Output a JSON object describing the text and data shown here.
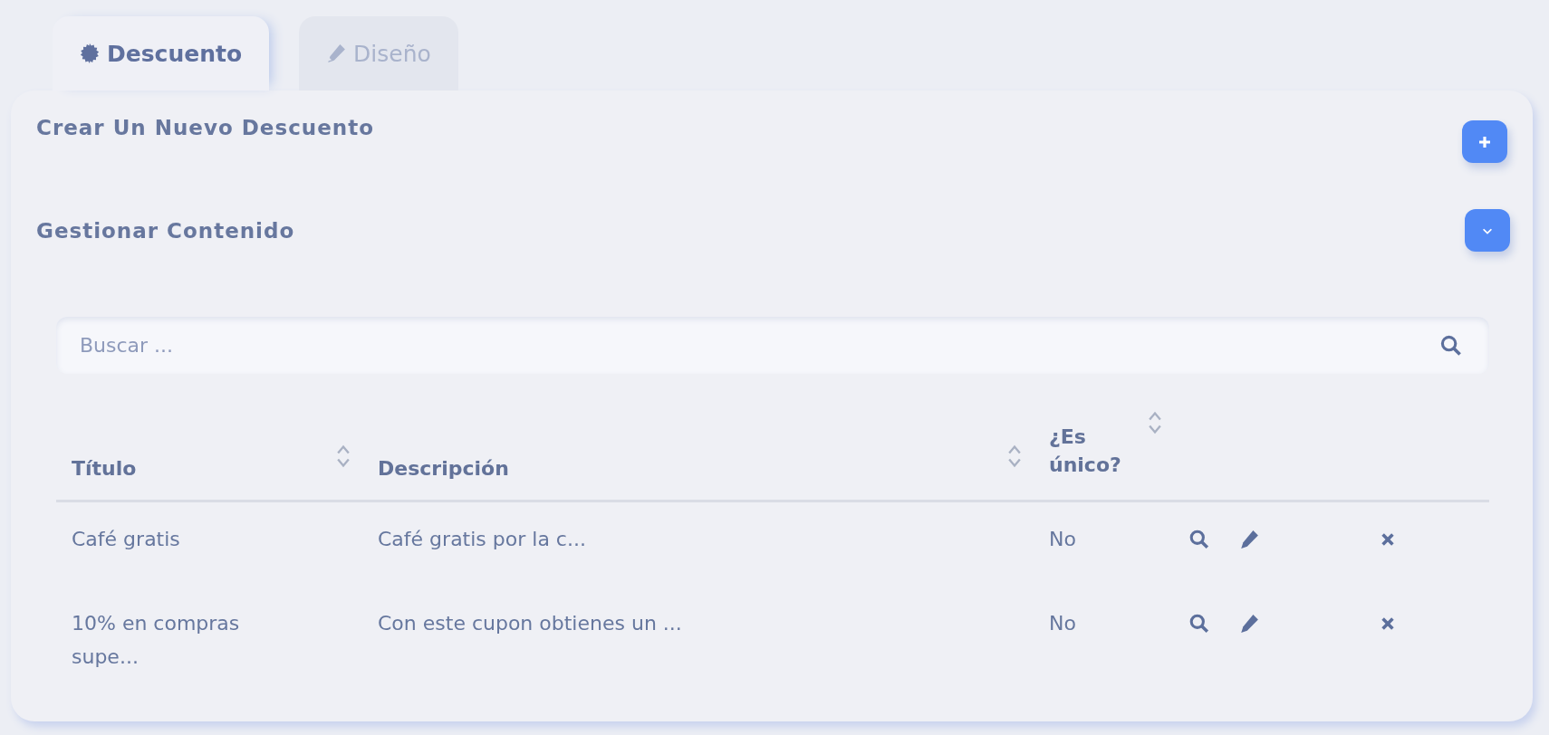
{
  "tabs": [
    {
      "label": "Descuento",
      "kind": "gear",
      "selected": true
    },
    {
      "label": "Diseño",
      "kind": "pencil",
      "selected": false
    }
  ],
  "sections": [
    {
      "title": "Crear Un Nuevo Descuento",
      "kind": "add"
    },
    {
      "title": "Gestionar Contenido",
      "kind": "expand"
    }
  ],
  "search": {
    "placeholder": "Buscar ..."
  },
  "table": {
    "columns": [
      "Título",
      "Descripción",
      "¿Es único?"
    ],
    "rows": [
      {
        "cells": [
          "Café gratis",
          "Café gratis por la c...",
          "No"
        ]
      },
      {
        "cells": [
          "10% en compras supe...",
          "Con este cupon obtienes un ...",
          "No"
        ]
      }
    ]
  }
}
